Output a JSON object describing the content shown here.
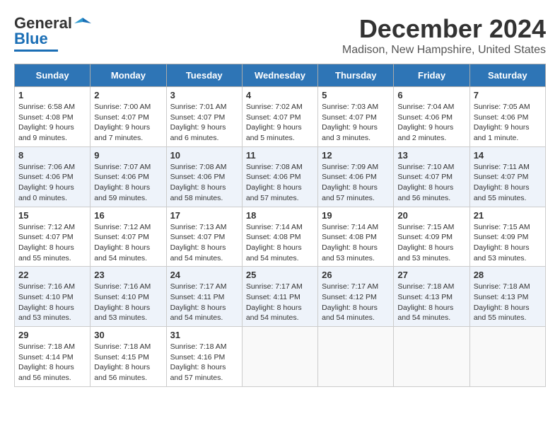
{
  "logo": {
    "general": "General",
    "blue": "Blue"
  },
  "header": {
    "month_title": "December 2024",
    "location": "Madison, New Hampshire, United States"
  },
  "days_of_week": [
    "Sunday",
    "Monday",
    "Tuesday",
    "Wednesday",
    "Thursday",
    "Friday",
    "Saturday"
  ],
  "weeks": [
    [
      {
        "day": "1",
        "sunrise": "Sunrise: 6:58 AM",
        "sunset": "Sunset: 4:08 PM",
        "daylight": "Daylight: 9 hours and 9 minutes."
      },
      {
        "day": "2",
        "sunrise": "Sunrise: 7:00 AM",
        "sunset": "Sunset: 4:07 PM",
        "daylight": "Daylight: 9 hours and 7 minutes."
      },
      {
        "day": "3",
        "sunrise": "Sunrise: 7:01 AM",
        "sunset": "Sunset: 4:07 PM",
        "daylight": "Daylight: 9 hours and 6 minutes."
      },
      {
        "day": "4",
        "sunrise": "Sunrise: 7:02 AM",
        "sunset": "Sunset: 4:07 PM",
        "daylight": "Daylight: 9 hours and 5 minutes."
      },
      {
        "day": "5",
        "sunrise": "Sunrise: 7:03 AM",
        "sunset": "Sunset: 4:07 PM",
        "daylight": "Daylight: 9 hours and 3 minutes."
      },
      {
        "day": "6",
        "sunrise": "Sunrise: 7:04 AM",
        "sunset": "Sunset: 4:06 PM",
        "daylight": "Daylight: 9 hours and 2 minutes."
      },
      {
        "day": "7",
        "sunrise": "Sunrise: 7:05 AM",
        "sunset": "Sunset: 4:06 PM",
        "daylight": "Daylight: 9 hours and 1 minute."
      }
    ],
    [
      {
        "day": "8",
        "sunrise": "Sunrise: 7:06 AM",
        "sunset": "Sunset: 4:06 PM",
        "daylight": "Daylight: 9 hours and 0 minutes."
      },
      {
        "day": "9",
        "sunrise": "Sunrise: 7:07 AM",
        "sunset": "Sunset: 4:06 PM",
        "daylight": "Daylight: 8 hours and 59 minutes."
      },
      {
        "day": "10",
        "sunrise": "Sunrise: 7:08 AM",
        "sunset": "Sunset: 4:06 PM",
        "daylight": "Daylight: 8 hours and 58 minutes."
      },
      {
        "day": "11",
        "sunrise": "Sunrise: 7:08 AM",
        "sunset": "Sunset: 4:06 PM",
        "daylight": "Daylight: 8 hours and 57 minutes."
      },
      {
        "day": "12",
        "sunrise": "Sunrise: 7:09 AM",
        "sunset": "Sunset: 4:06 PM",
        "daylight": "Daylight: 8 hours and 57 minutes."
      },
      {
        "day": "13",
        "sunrise": "Sunrise: 7:10 AM",
        "sunset": "Sunset: 4:07 PM",
        "daylight": "Daylight: 8 hours and 56 minutes."
      },
      {
        "day": "14",
        "sunrise": "Sunrise: 7:11 AM",
        "sunset": "Sunset: 4:07 PM",
        "daylight": "Daylight: 8 hours and 55 minutes."
      }
    ],
    [
      {
        "day": "15",
        "sunrise": "Sunrise: 7:12 AM",
        "sunset": "Sunset: 4:07 PM",
        "daylight": "Daylight: 8 hours and 55 minutes."
      },
      {
        "day": "16",
        "sunrise": "Sunrise: 7:12 AM",
        "sunset": "Sunset: 4:07 PM",
        "daylight": "Daylight: 8 hours and 54 minutes."
      },
      {
        "day": "17",
        "sunrise": "Sunrise: 7:13 AM",
        "sunset": "Sunset: 4:07 PM",
        "daylight": "Daylight: 8 hours and 54 minutes."
      },
      {
        "day": "18",
        "sunrise": "Sunrise: 7:14 AM",
        "sunset": "Sunset: 4:08 PM",
        "daylight": "Daylight: 8 hours and 54 minutes."
      },
      {
        "day": "19",
        "sunrise": "Sunrise: 7:14 AM",
        "sunset": "Sunset: 4:08 PM",
        "daylight": "Daylight: 8 hours and 53 minutes."
      },
      {
        "day": "20",
        "sunrise": "Sunrise: 7:15 AM",
        "sunset": "Sunset: 4:09 PM",
        "daylight": "Daylight: 8 hours and 53 minutes."
      },
      {
        "day": "21",
        "sunrise": "Sunrise: 7:15 AM",
        "sunset": "Sunset: 4:09 PM",
        "daylight": "Daylight: 8 hours and 53 minutes."
      }
    ],
    [
      {
        "day": "22",
        "sunrise": "Sunrise: 7:16 AM",
        "sunset": "Sunset: 4:10 PM",
        "daylight": "Daylight: 8 hours and 53 minutes."
      },
      {
        "day": "23",
        "sunrise": "Sunrise: 7:16 AM",
        "sunset": "Sunset: 4:10 PM",
        "daylight": "Daylight: 8 hours and 53 minutes."
      },
      {
        "day": "24",
        "sunrise": "Sunrise: 7:17 AM",
        "sunset": "Sunset: 4:11 PM",
        "daylight": "Daylight: 8 hours and 54 minutes."
      },
      {
        "day": "25",
        "sunrise": "Sunrise: 7:17 AM",
        "sunset": "Sunset: 4:11 PM",
        "daylight": "Daylight: 8 hours and 54 minutes."
      },
      {
        "day": "26",
        "sunrise": "Sunrise: 7:17 AM",
        "sunset": "Sunset: 4:12 PM",
        "daylight": "Daylight: 8 hours and 54 minutes."
      },
      {
        "day": "27",
        "sunrise": "Sunrise: 7:18 AM",
        "sunset": "Sunset: 4:13 PM",
        "daylight": "Daylight: 8 hours and 54 minutes."
      },
      {
        "day": "28",
        "sunrise": "Sunrise: 7:18 AM",
        "sunset": "Sunset: 4:13 PM",
        "daylight": "Daylight: 8 hours and 55 minutes."
      }
    ],
    [
      {
        "day": "29",
        "sunrise": "Sunrise: 7:18 AM",
        "sunset": "Sunset: 4:14 PM",
        "daylight": "Daylight: 8 hours and 56 minutes."
      },
      {
        "day": "30",
        "sunrise": "Sunrise: 7:18 AM",
        "sunset": "Sunset: 4:15 PM",
        "daylight": "Daylight: 8 hours and 56 minutes."
      },
      {
        "day": "31",
        "sunrise": "Sunrise: 7:18 AM",
        "sunset": "Sunset: 4:16 PM",
        "daylight": "Daylight: 8 hours and 57 minutes."
      },
      null,
      null,
      null,
      null
    ]
  ]
}
